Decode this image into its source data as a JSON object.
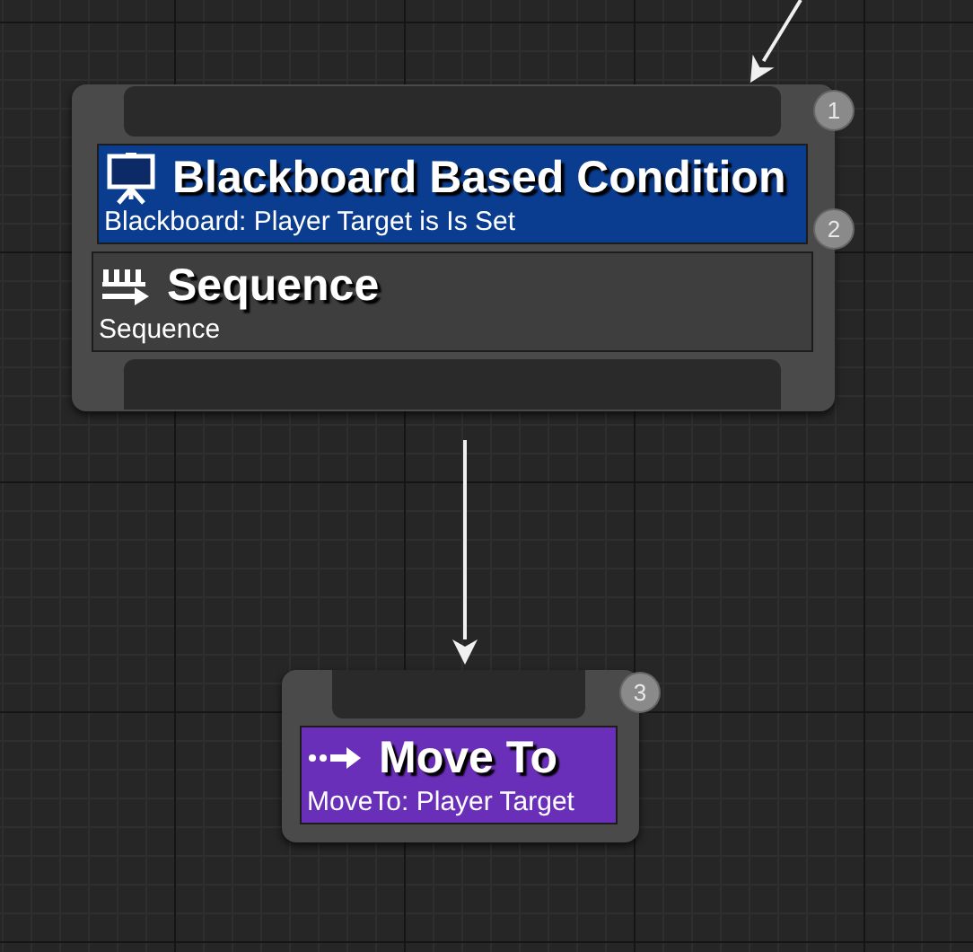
{
  "graph": {
    "nodes": [
      {
        "kind": "composite",
        "order": "1",
        "title": "Sequence",
        "subtitle": "Sequence",
        "decorators": [
          {
            "kind": "decorator",
            "order": "2",
            "title": "Blackboard Based Condition",
            "subtitle": "Blackboard: Player Target is Is Set"
          }
        ]
      },
      {
        "kind": "task",
        "order": "3",
        "title": "Move To",
        "subtitle": "MoveTo: Player Target"
      }
    ]
  }
}
